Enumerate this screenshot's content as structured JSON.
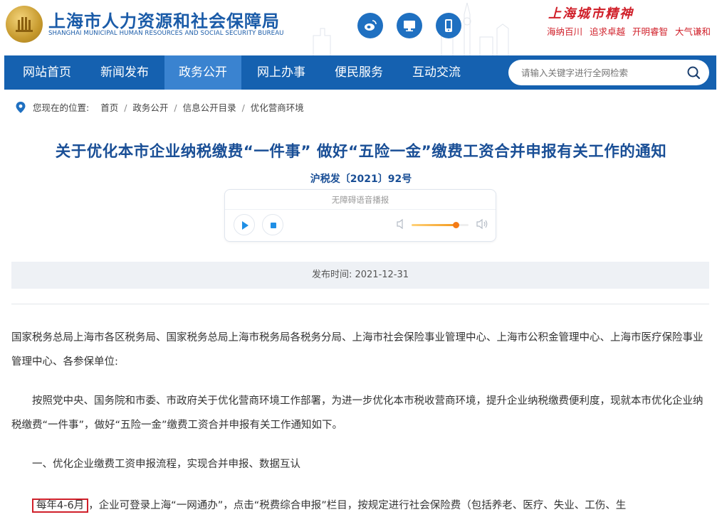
{
  "header": {
    "title": "上海市人力资源和社会保障局",
    "subtitle": "SHANGHAI MUNICIPAL HUMAN RESOURCES AND SOCIAL SECURITY BUREAU",
    "spirit_title": "上海城市精神",
    "spirit_words": [
      "海纳百川",
      "追求卓越",
      "开明睿智",
      "大气谦和"
    ],
    "social_icons": [
      "weibo-icon",
      "desktop-icon",
      "mobile-icon"
    ],
    "brand_color": "#1561b0",
    "accent_red": "#d0202a"
  },
  "nav": {
    "items": [
      "网站首页",
      "新闻发布",
      "政务公开",
      "网上办事",
      "便民服务",
      "互动交流"
    ],
    "active": "政务公开",
    "search_placeholder": "请输入关键字进行全网检索"
  },
  "breadcrumb": {
    "label": "您现在的位置:",
    "items": [
      "首页",
      "政务公开",
      "信息公开目录",
      "优化营商环境"
    ]
  },
  "article": {
    "title": "关于优化本市企业纳税缴费“一件事” 做好“五险一金”缴费工资合并申报有关工作的通知",
    "doc_number": "沪税发〔2021〕92号",
    "player_label": "无障碍语音播报",
    "volume_level": 0.78,
    "publish_label": "发布时间:",
    "publish_date": "2021-12-31",
    "paragraphs": {
      "p1": "国家税务总局上海市各区税务局、国家税务总局上海市税务局各税务分局、上海市社会保险事业管理中心、上海市公积金管理中心、上海市医疗保险事业管理中心、各参保单位:",
      "p2": "按照党中央、国务院和市委、市政府关于优化营商环境工作部署，为进一步优化本市税收营商环境，提升企业纳税缴费便利度，现就本市优化企业纳税缴费“一件事”，做好“五险一金”缴费工资合并申报有关工作通知如下。",
      "p3": "一、优化企业缴费工资申报流程，实现合并申报、数据互认",
      "p4_highlight": "每年4-6月",
      "p4_rest": "，企业可登录上海“一网通办”，点击“税费综合申报”栏目，按规定进行社会保险费（包括养老、医疗、失业、工伤、生"
    }
  }
}
